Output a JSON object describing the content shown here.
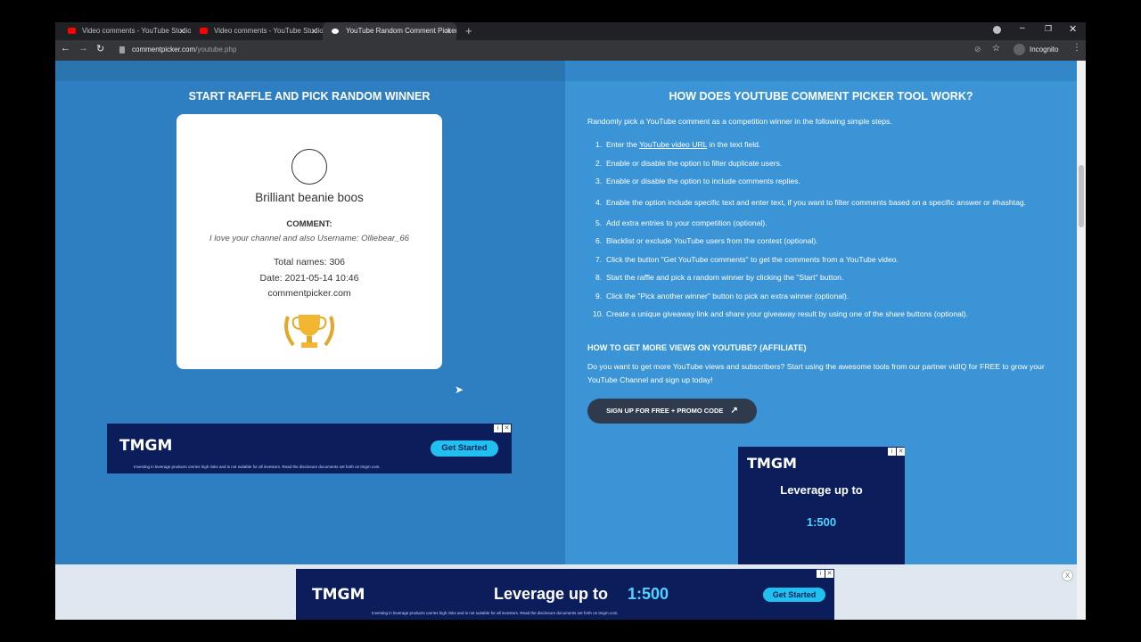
{
  "browser": {
    "tabs": [
      {
        "title": "Video comments - YouTube Studio",
        "favicon": "youtube-icon"
      },
      {
        "title": "Video comments - YouTube Studio",
        "favicon": "youtube-icon"
      },
      {
        "title": "YouTube Random Comment Picker",
        "favicon": "commentpicker-icon",
        "active": true
      }
    ],
    "new_tab": "+",
    "url_host": "commentpicker.com",
    "url_path": "/youtube.php",
    "profile_label": "Incognito"
  },
  "left": {
    "heading": "START RAFFLE AND PICK RANDOM WINNER",
    "card": {
      "winner_name": "Brilliant beanie boos",
      "comment_label": "COMMENT:",
      "comment_text": "I love your channel and also Username: Olliebear_66",
      "total_names": "Total names: 306",
      "date": "Date: 2021-05-14 10:46",
      "site": "commentpicker.com",
      "trophy_icon": "trophy-icon"
    }
  },
  "right": {
    "heading": "HOW DOES YOUTUBE COMMENT PICKER TOOL WORK?",
    "intro": "Randomly pick a YouTube comment as a competition winner in the following simple steps.",
    "steps": [
      {
        "num": "1.",
        "pre": "Enter the ",
        "link": "YouTube video URL",
        "post": " in the text field."
      },
      {
        "num": "2.",
        "text": "Enable or disable the option to filter duplicate users."
      },
      {
        "num": "3.",
        "text": "Enable or disable the option to include comments replies."
      },
      {
        "num": "4.",
        "text": "Enable the option include specific text and enter text, if you want to filter comments based on a specific answer or #hashtag."
      },
      {
        "num": "5.",
        "text": "Add extra entries to your competition (optional)."
      },
      {
        "num": "6.",
        "text": "Blacklist or exclude YouTube users from the contest (optional)."
      },
      {
        "num": "7.",
        "text": "Click the button \"Get YouTube comments\" to get the comments from a YouTube video."
      },
      {
        "num": "8.",
        "text": "Start the raffle and pick a random winner by clicking the \"Start\" button."
      },
      {
        "num": "9.",
        "text": "Click the \"Pick another winner\" button to pick an extra winner (optional)."
      },
      {
        "num": "10.",
        "text": "Create a unique giveaway link and share your giveaway result by using one of the share buttons (optional)."
      }
    ],
    "views_heading": "HOW TO GET MORE VIEWS ON YOUTUBE? (AFFILIATE)",
    "views_text": "Do you want to get more YouTube views and subscribers? Start using the awesome tools from our partner vidIQ for FREE to grow your YouTube Channel and sign up today!",
    "signup_button": "SIGN UP FOR FREE + PROMO CODE"
  },
  "ads": {
    "brand": "TMGM",
    "cta": "Get Started",
    "disclaimer": "Investing in leverage products carries high risks and is not suitable for all investors. Read the disclosure documents set forth on tmgm.com.",
    "leverage_text": "Leverage up to",
    "leverage_ratio": "1:500",
    "close_label": "X"
  }
}
